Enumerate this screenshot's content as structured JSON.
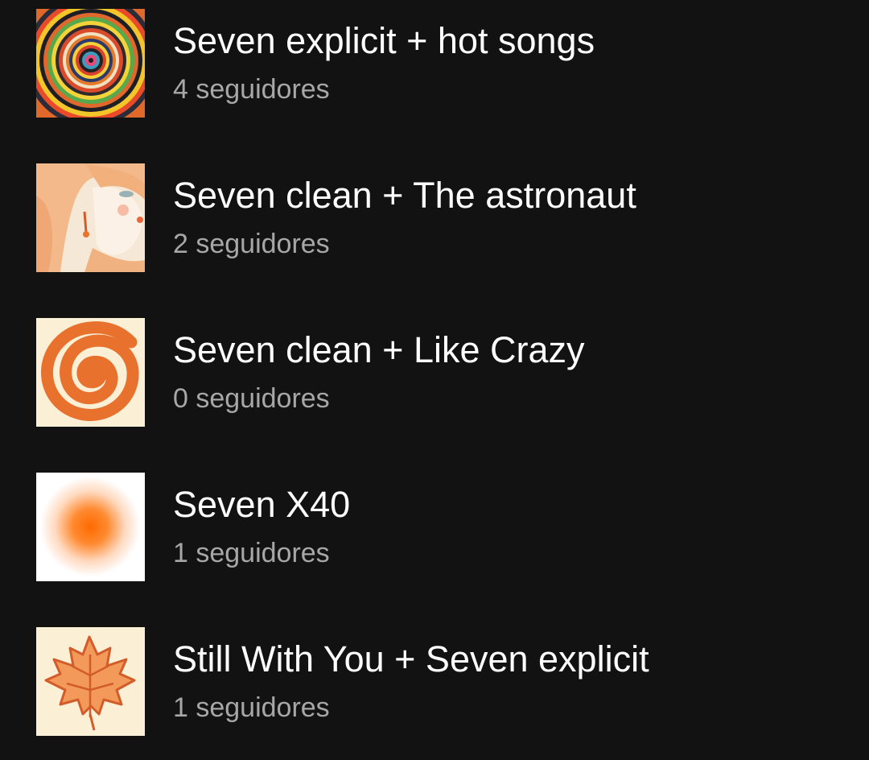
{
  "playlists": [
    {
      "title": "Seven explicit + hot songs",
      "followers": "4 seguidores",
      "cover": "concentric-circles-art"
    },
    {
      "title": "Seven clean + The astronaut",
      "followers": "2 seguidores",
      "cover": "anime-girl-illustration"
    },
    {
      "title": "Seven clean + Like Crazy",
      "followers": "0 seguidores",
      "cover": "orange-spiral"
    },
    {
      "title": "Seven X40",
      "followers": "1 seguidores",
      "cover": "orange-blur-gradient"
    },
    {
      "title": "Still With You + Seven explicit",
      "followers": "1 seguidores",
      "cover": "orange-maple-leaf"
    }
  ],
  "colors": {
    "background": "#121212",
    "title": "#ffffff",
    "subtitle": "#a7a7a7",
    "accent": "#ee7733"
  }
}
